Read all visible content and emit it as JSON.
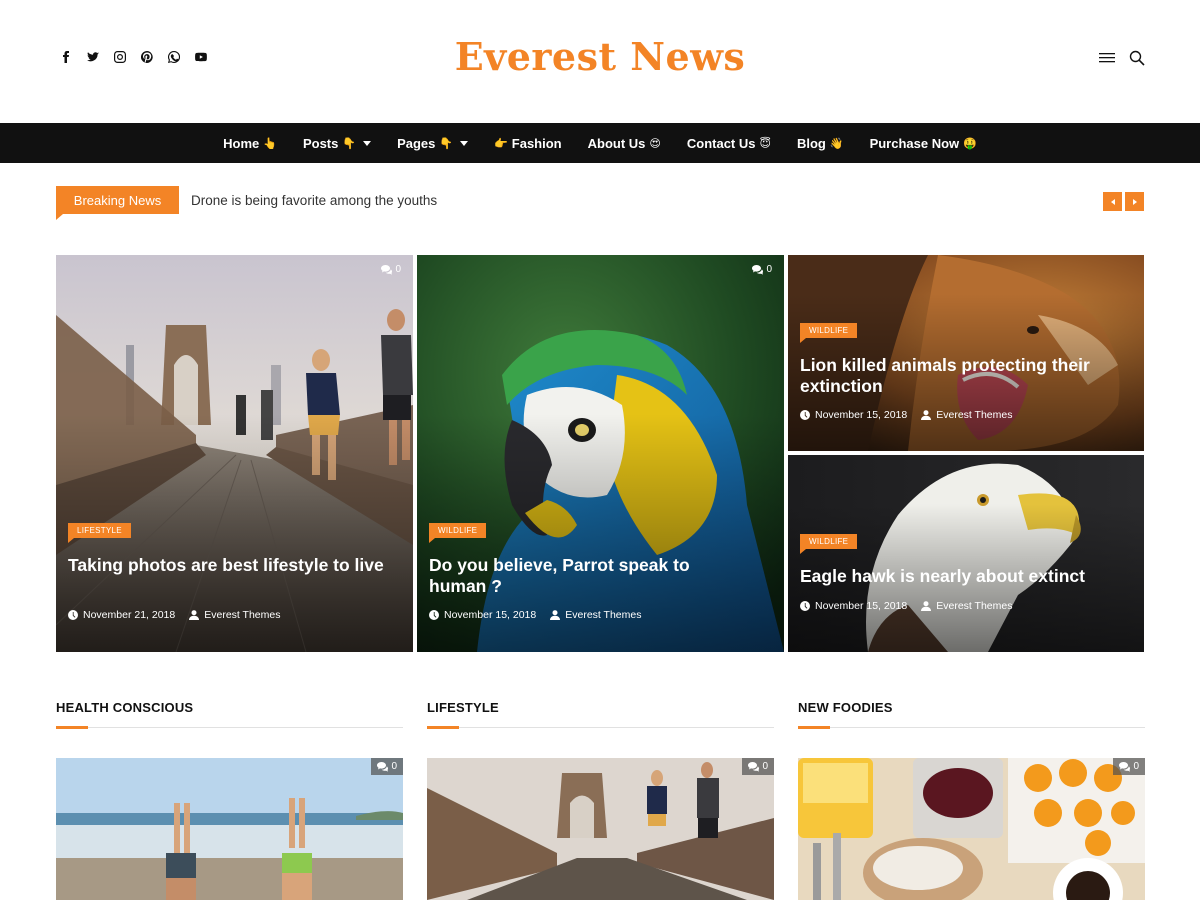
{
  "site": {
    "logo": "Everest News",
    "brand_color": "#f38426"
  },
  "social_icons": [
    "facebook-icon",
    "twitter-icon",
    "instagram-icon",
    "pinterest-icon",
    "whatsapp-icon",
    "youtube-icon"
  ],
  "header_icons": [
    "menu-icon",
    "search-icon"
  ],
  "nav": {
    "items": [
      {
        "label": "Home",
        "emoji": "👆",
        "dropdown": false
      },
      {
        "label": "Posts",
        "emoji": "👇",
        "dropdown": true
      },
      {
        "label": "Pages",
        "emoji": "👇",
        "dropdown": true
      },
      {
        "label": "Fashion",
        "emoji": "👉",
        "dropdown": false,
        "emoji_before": true
      },
      {
        "label": "About Us",
        "emoji": "😍",
        "dropdown": false
      },
      {
        "label": "Contact Us",
        "emoji": "😇",
        "dropdown": false
      },
      {
        "label": "Blog",
        "emoji": "👋",
        "dropdown": false
      },
      {
        "label": "Purchase Now",
        "emoji": "🤑",
        "dropdown": false
      }
    ]
  },
  "breaking": {
    "label": "Breaking News",
    "headline": "Drone is being favorite among the youths"
  },
  "featured": [
    {
      "category": "LIFESTYLE",
      "title": "Taking photos are best lifestyle to live",
      "date": "November 21, 2018",
      "author": "Everest Themes",
      "comments": "0"
    },
    {
      "category": "WILDLIFE",
      "title": "Do you believe, Parrot speak to human ?",
      "date": "November 15, 2018",
      "author": "Everest Themes",
      "comments": "0"
    },
    {
      "category": "WILDLIFE",
      "title": "Lion killed animals protecting their extinction",
      "date": "November 15, 2018",
      "author": "Everest Themes",
      "comments": ""
    },
    {
      "category": "WILDLIFE",
      "title": "Eagle hawk is nearly about extinct",
      "date": "November 15, 2018",
      "author": "Everest Themes",
      "comments": ""
    }
  ],
  "sections": [
    {
      "title": "HEALTH CONSCIOUS",
      "comments": "0"
    },
    {
      "title": "LIFESTYLE",
      "comments": "0"
    },
    {
      "title": "NEW FOODIES",
      "comments": "0"
    }
  ]
}
